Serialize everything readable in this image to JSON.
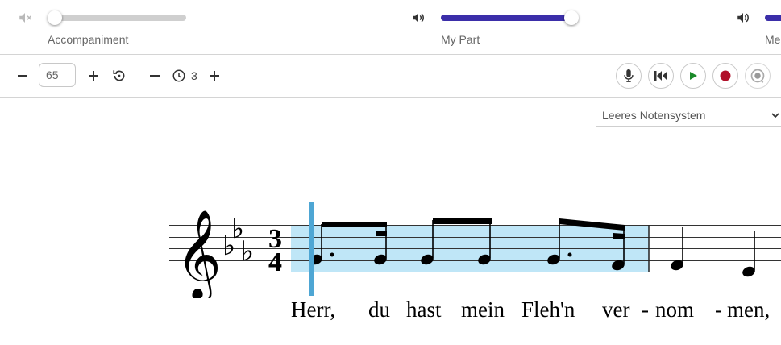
{
  "mixer": {
    "tracks": [
      {
        "label": "Accompaniment",
        "muted": true,
        "level": 0.0
      },
      {
        "label": "My Part",
        "muted": false,
        "level": 1.0
      },
      {
        "label": "Me",
        "muted": false,
        "level": 1.0
      }
    ],
    "accent_color": "#3b2ea9"
  },
  "toolbar": {
    "tempo_value": "65",
    "count_in": "3",
    "icons": [
      "minus-icon",
      "plus-icon",
      "reset-icon",
      "minus-icon",
      "clock-icon",
      "plus-icon",
      "microphone-icon",
      "skip-back-icon",
      "play-icon",
      "record-icon",
      "record-loop-icon"
    ],
    "play_color": "#1a8a2a",
    "record_color": "#b0102a"
  },
  "score_select": {
    "value": "Leeres Notensystem"
  },
  "score": {
    "clef": "treble",
    "key_signature": "E-flat major (3 flats)",
    "time_signature": {
      "top": "3",
      "bottom": "4"
    },
    "highlight_color": "#bfe6f7",
    "cursor_color": "#4ea6d4"
  },
  "lyrics": [
    "Herr,",
    "du",
    "hast",
    "mein",
    "Fleh'n",
    "ver",
    "-",
    "nom",
    "-",
    "men,"
  ]
}
